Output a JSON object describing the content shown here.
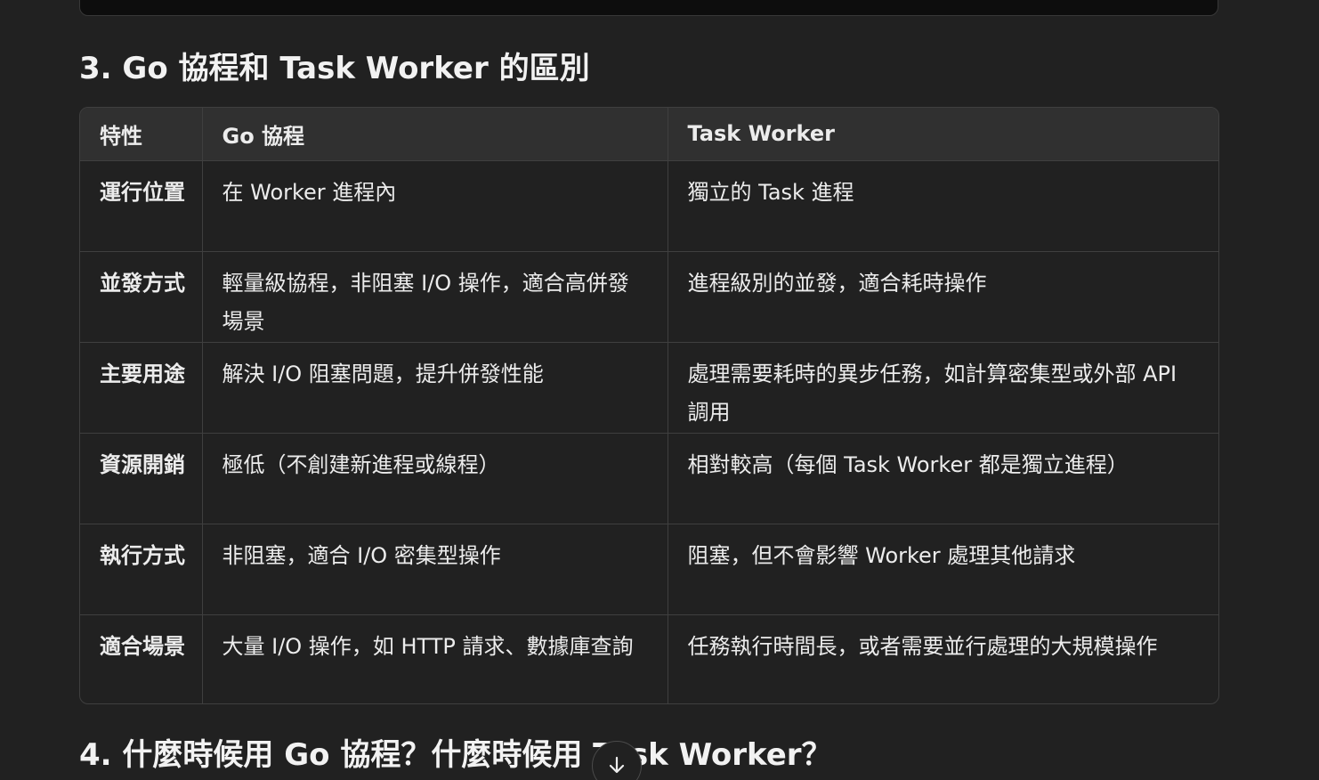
{
  "section3": {
    "heading": "3. Go 協程和 Task Worker 的區別"
  },
  "table": {
    "headers": [
      "特性",
      "Go 協程",
      "Task Worker"
    ],
    "rows": [
      [
        "運行位置",
        "在 Worker 進程內",
        "獨立的 Task 進程"
      ],
      [
        "並發方式",
        "輕量級協程，非阻塞 I/O 操作，適合高併發場景",
        "進程級別的並發，適合耗時操作"
      ],
      [
        "主要用途",
        "解決 I/O 阻塞問題，提升併發性能",
        "處理需要耗時的異步任務，如計算密集型或外部 API 調用"
      ],
      [
        "資源開銷",
        "極低（不創建新進程或線程）",
        "相對較高（每個 Task Worker 都是獨立進程）"
      ],
      [
        "執行方式",
        "非阻塞，適合 I/O 密集型操作",
        "阻塞，但不會影響 Worker 處理其他請求"
      ],
      [
        "適合場景",
        "大量 I/O 操作，如 HTTP 請求、數據庫查詢",
        "任務執行時間長，或者需要並行處理的大規模操作"
      ]
    ]
  },
  "section4": {
    "heading": "4. 什麼時候用 Go 協程？什麼時候用 Task Worker？"
  },
  "scroll_button": {
    "icon": "arrow-down-icon"
  }
}
